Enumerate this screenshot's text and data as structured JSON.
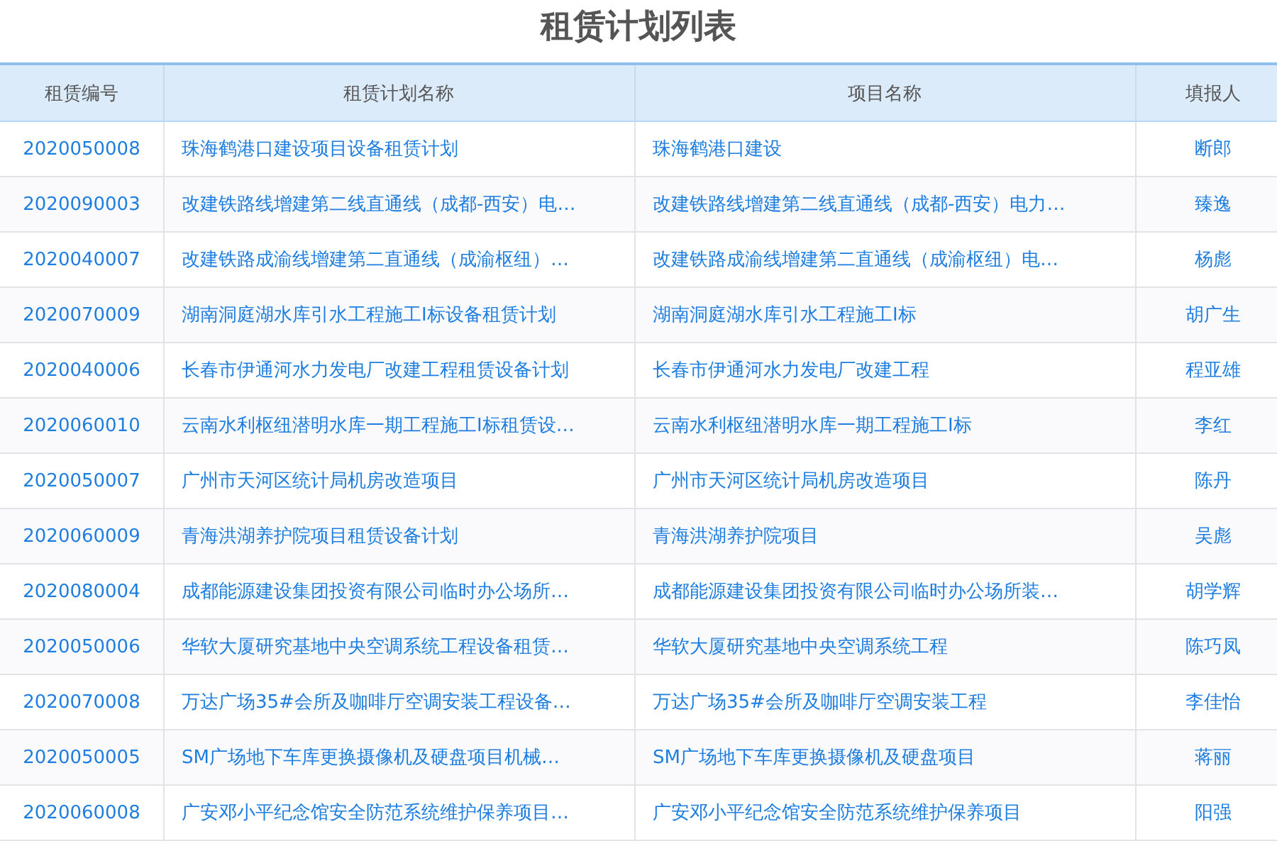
{
  "title": "租赁计划列表",
  "table": {
    "columns": [
      "租赁编号",
      "租赁计划名称",
      "项目名称",
      "填报人"
    ],
    "rows": [
      [
        "2020050008",
        "珠海鹤港口建设项目设备租赁计划",
        "珠海鹤港口建设",
        "断郎"
      ],
      [
        "2020090003",
        "改建铁路线增建第二线直通线（成都-西安）电…",
        "改建铁路线增建第二线直通线（成都-西安）电力…",
        "臻逸"
      ],
      [
        "2020040007",
        "改建铁路成渝线增建第二直通线（成渝枢纽）…",
        "改建铁路成渝线增建第二直通线（成渝枢纽）电…",
        "杨彪"
      ],
      [
        "2020070009",
        "湖南洞庭湖水库引水工程施工I标设备租赁计划",
        "湖南洞庭湖水库引水工程施工I标",
        "胡广生"
      ],
      [
        "2020040006",
        "长春市伊通河水力发电厂改建工程租赁设备计划",
        "长春市伊通河水力发电厂改建工程",
        "程亚雄"
      ],
      [
        "2020060010",
        "云南水利枢纽潜明水库一期工程施工I标租赁设…",
        "云南水利枢纽潜明水库一期工程施工I标",
        "李红"
      ],
      [
        "2020050007",
        "广州市天河区统计局机房改造项目",
        "广州市天河区统计局机房改造项目",
        "陈丹"
      ],
      [
        "2020060009",
        "青海洪湖养护院项目租赁设备计划",
        "青海洪湖养护院项目",
        "吴彪"
      ],
      [
        "2020080004",
        "成都能源建设集团投资有限公司临时办公场所…",
        "成都能源建设集团投资有限公司临时办公场所装…",
        "胡学辉"
      ],
      [
        "2020050006",
        "华软大厦研究基地中央空调系统工程设备租赁…",
        "华软大厦研究基地中央空调系统工程",
        "陈巧凤"
      ],
      [
        "2020070008",
        "万达广场35#会所及咖啡厅空调安装工程设备…",
        "万达广场35#会所及咖啡厅空调安装工程",
        "李佳怡"
      ],
      [
        "2020050005",
        "SM广场地下车库更换摄像机及硬盘项目机械…",
        "SM广场地下车库更换摄像机及硬盘项目",
        "蒋丽"
      ],
      [
        "2020060008",
        "广安邓小平纪念馆安全防范系统维护保养项目…",
        "广安邓小平纪念馆安全防范系统维护保养项目",
        "阳强"
      ]
    ]
  }
}
